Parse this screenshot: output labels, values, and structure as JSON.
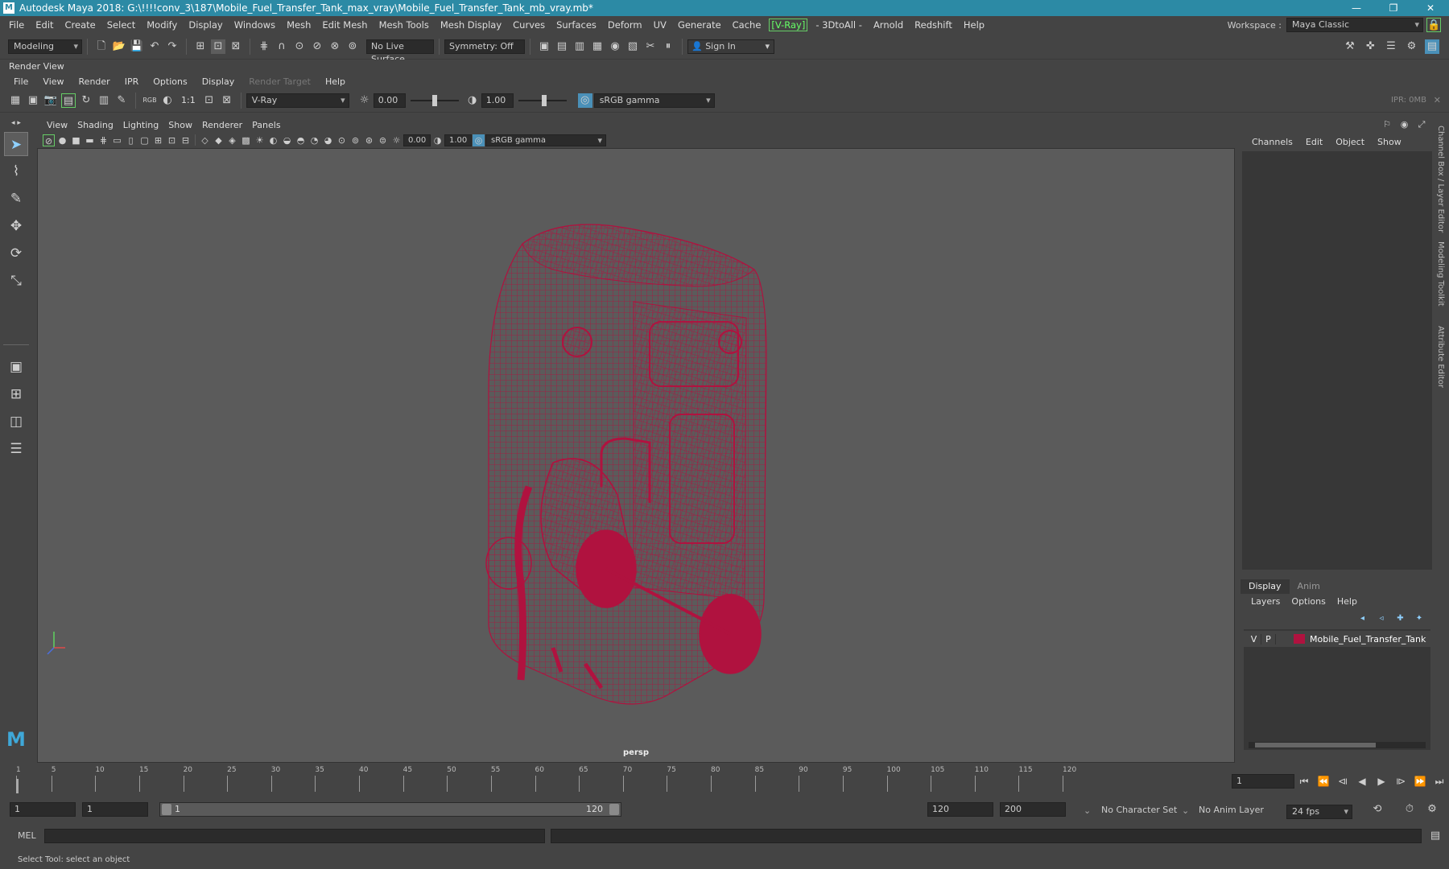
{
  "window": {
    "title": "Autodesk Maya 2018: G:\\!!!!conv_3\\187\\Mobile_Fuel_Transfer_Tank_max_vray\\Mobile_Fuel_Transfer_Tank_mb_vray.mb*",
    "minimize": "—",
    "maximize": "❐",
    "close": "✕"
  },
  "main_menu": [
    "File",
    "Edit",
    "Create",
    "Select",
    "Modify",
    "Display",
    "Windows",
    "Mesh",
    "Edit Mesh",
    "Mesh Tools",
    "Mesh Display",
    "Curves",
    "Surfaces",
    "Deform",
    "UV",
    "Generate",
    "Cache",
    "[V-Ray]",
    "- 3DtoAll -",
    "Arnold",
    "Redshift",
    "Help"
  ],
  "workspace": {
    "label": "Workspace :",
    "value": "Maya Classic"
  },
  "shelf": {
    "mode": "Modeling",
    "live_surface": "No Live Surface",
    "symmetry": "Symmetry: Off",
    "sign_in": "Sign In"
  },
  "render_view": {
    "title": "Render View",
    "menu": [
      "File",
      "View",
      "Render",
      "IPR",
      "Options",
      "Display",
      "Render Target",
      "Help"
    ],
    "disabled_menu": "Render Target",
    "ratio": "1:1",
    "rgb": "RGB",
    "renderer": "V-Ray",
    "exposure": "0.00",
    "gamma": "1.00",
    "colorspace": "sRGB gamma",
    "ipr": "IPR: 0MB",
    "exposure_level": 0.5,
    "gamma_level": 0.55
  },
  "viewport": {
    "menu": [
      "View",
      "Shading",
      "Lighting",
      "Show",
      "Renderer",
      "Panels"
    ],
    "exposure": "0.00",
    "gamma": "1.00",
    "colorspace": "sRGB gamma",
    "camera_label": "persp",
    "wire_color": "#b0123f",
    "axis": {
      "x": "x",
      "y": "y",
      "z": "z"
    }
  },
  "channel_box": {
    "menu": [
      "Channels",
      "Edit",
      "Object",
      "Show"
    ]
  },
  "layer_editor": {
    "tabs": [
      "Display",
      "Anim"
    ],
    "menu": [
      "Layers",
      "Options",
      "Help"
    ],
    "layer": {
      "visible": "V",
      "playback": "P",
      "color": "#b0123f",
      "name": "Mobile_Fuel_Transfer_Tank"
    }
  },
  "side_tabs": [
    "Channel Box / Layer Editor",
    "Modeling Toolkit",
    "Attribute Editor"
  ],
  "timeline": {
    "ticks": [
      "1",
      "5",
      "10",
      "15",
      "20",
      "25",
      "30",
      "35",
      "40",
      "45",
      "50",
      "55",
      "60",
      "65",
      "70",
      "75",
      "80",
      "85",
      "90",
      "95",
      "100",
      "105",
      "110",
      "115",
      "120"
    ],
    "current_frame": "1"
  },
  "range": {
    "start_field": "1",
    "anim_start": "1",
    "slider_start": "1",
    "slider_end": "120",
    "end_field": "120",
    "anim_end": "200",
    "character_set": "No Character Set",
    "anim_layer": "No Anim Layer",
    "fps": "24 fps"
  },
  "mel": {
    "label": "MEL"
  },
  "status": {
    "help_line": "Select Tool: select an object"
  }
}
